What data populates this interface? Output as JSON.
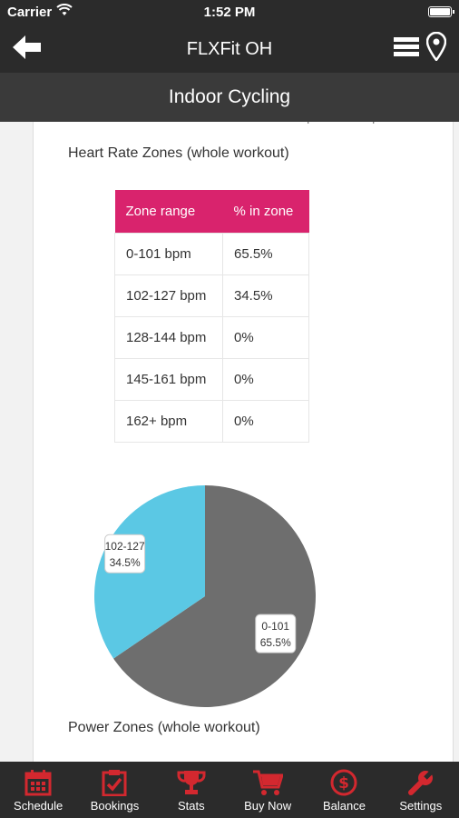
{
  "status_bar": {
    "carrier": "Carrier",
    "time": "1:52 PM"
  },
  "nav": {
    "title": "FLXFit OH"
  },
  "sub_header": {
    "title": "Indoor Cycling"
  },
  "content": {
    "rpm_labels": [
      "rpm",
      "rpm"
    ],
    "hr_zones_title": "Heart Rate Zones (whole workout)",
    "table": {
      "headers": [
        "Zone range",
        "% in zone"
      ],
      "rows": [
        [
          "0-101 bpm",
          "65.5%"
        ],
        [
          "102-127 bpm",
          "34.5%"
        ],
        [
          "128-144 bpm",
          "0%"
        ],
        [
          "145-161 bpm",
          "0%"
        ],
        [
          "162+ bpm",
          "0%"
        ]
      ]
    },
    "pie": {
      "slices": [
        {
          "label": "0-101",
          "percent_label": "65.5%",
          "value": 65.5,
          "color": "#6e6e6e"
        },
        {
          "label": "102-127",
          "percent_label": "34.5%",
          "value": 34.5,
          "color": "#5bc8e4"
        }
      ]
    },
    "power_zones_title": "Power Zones (whole workout)"
  },
  "tabs": [
    {
      "label": "Schedule",
      "icon": "calendar-icon"
    },
    {
      "label": "Bookings",
      "icon": "clipboard-check-icon"
    },
    {
      "label": "Stats",
      "icon": "trophy-icon"
    },
    {
      "label": "Buy Now",
      "icon": "cart-icon"
    },
    {
      "label": "Balance",
      "icon": "dollar-icon"
    },
    {
      "label": "Settings",
      "icon": "wrench-icon"
    }
  ],
  "colors": {
    "accent": "#d9236d",
    "tab_icon": "#d3282f",
    "bar": "#2b2b2b"
  }
}
